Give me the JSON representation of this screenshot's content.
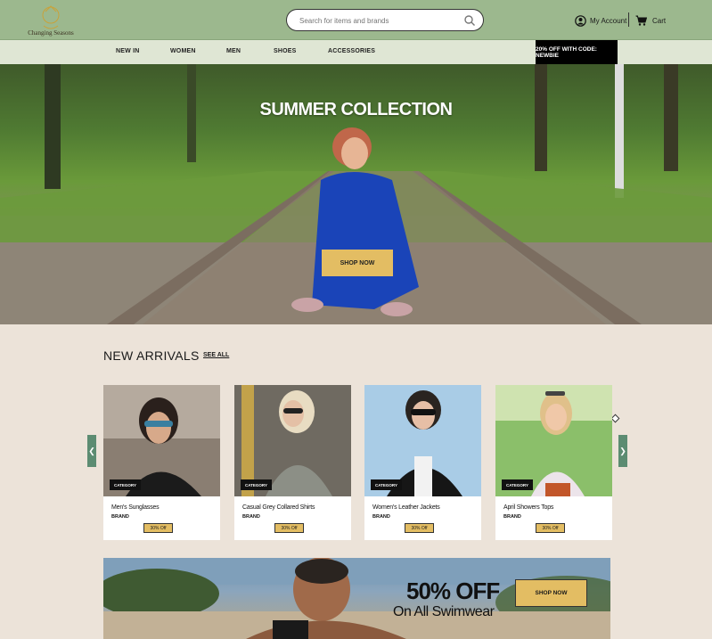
{
  "header": {
    "logo_text": "Changing Seasons",
    "search_placeholder": "Search for items and brands",
    "account_label": "My Account",
    "cart_label": "Cart"
  },
  "nav": {
    "items": [
      "NEW IN",
      "WOMEN",
      "MEN",
      "SHOES",
      "ACCESSORIES"
    ],
    "promo": "20% OFF WITH CODE: NEWBIE"
  },
  "hero": {
    "title": "SUMMER COLLECTION",
    "button": "SHOP NOW"
  },
  "new_arrivals": {
    "title": "NEW ARRIVALS",
    "see_all": "SEE ALL",
    "products": [
      {
        "category": "CATEGORY",
        "name": "Men's Sunglasses",
        "brand": "BRAND",
        "tag": "30% Off"
      },
      {
        "category": "CATEGORY",
        "name": "Casual Grey Collared Shirts",
        "brand": "BRAND",
        "tag": "30% Off"
      },
      {
        "category": "CATEGORY",
        "name": "Women's Leather Jackets",
        "brand": "BRAND",
        "tag": "30% Off"
      },
      {
        "category": "CATEGORY",
        "name": "April Showers Tops",
        "brand": "BRAND",
        "tag": "30% Off"
      }
    ]
  },
  "banner": {
    "headline": "50% OFF",
    "subline": "On All Swimwear",
    "button": "SHOP NOW"
  },
  "colors": {
    "header_bg": "#9cb88e",
    "nav_bg": "#dfe6d4",
    "accent_gold": "#e3bd63",
    "page_bg": "#ece3d9",
    "arrow_teal": "#5c8c72"
  }
}
